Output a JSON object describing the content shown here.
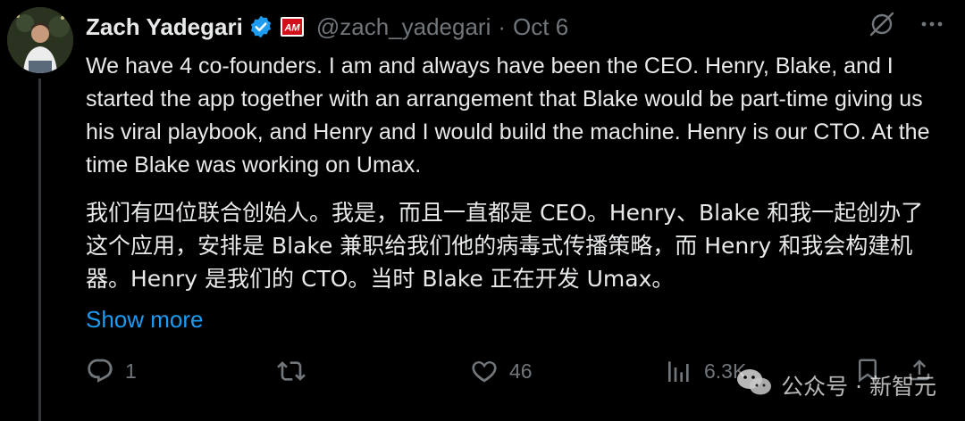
{
  "author": {
    "name": "Zach Yadegari",
    "handle": "@zach_yadegari",
    "separator": "·",
    "date": "Oct 6",
    "affiliate_badge_text": "AM"
  },
  "tweet": {
    "text_en": "We have 4 co-founders. I am and always have been the CEO. Henry, Blake, and I started the app together with an arrangement that Blake would be part-time giving us his viral playbook, and Henry and I would build the machine. Henry is our CTO. At the time Blake was working on Umax.",
    "text_zh": "我们有四位联合创始人。我是，而且一直都是 CEO。Henry、Blake 和我一起创办了这个应用，安排是 Blake 兼职给我们他的病毒式传播策略，而 Henry 和我会构建机器。Henry 是我们的 CTO。当时 Blake 正在开发 Umax。",
    "show_more": "Show more"
  },
  "actions": {
    "replies": "1",
    "retweets": "",
    "likes": "46",
    "views": "6.3K"
  },
  "watermark": {
    "text": "公众号 · 新智元"
  },
  "icons": {
    "verified": "verified-badge-icon",
    "grok": "grok-icon",
    "more": "more-dots-icon",
    "reply": "reply-icon",
    "retweet": "retweet-icon",
    "like": "heart-icon",
    "views": "views-chart-icon",
    "bookmark": "bookmark-icon",
    "share": "share-icon",
    "wechat": "wechat-icon"
  },
  "colors": {
    "background": "#000000",
    "text": "#e7e9ea",
    "muted": "#71767b",
    "accent": "#1d9bf0"
  }
}
